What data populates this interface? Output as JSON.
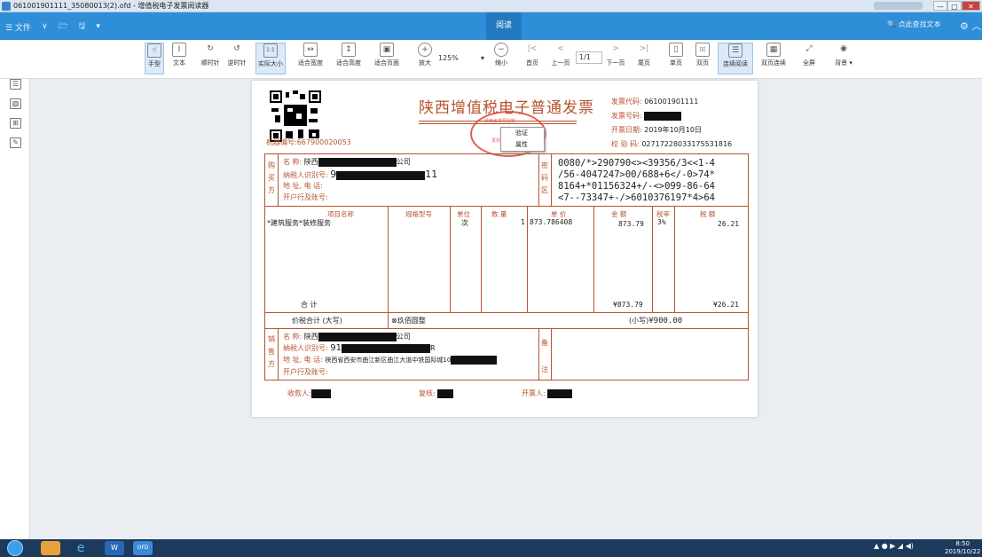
{
  "window": {
    "title": "061001901111_35080013(2).ofd - 增值税电子发票阅读器",
    "minimize": "—",
    "maximize": "□",
    "close": "✕"
  },
  "menubar": {
    "file": "☰ 文件",
    "items": [
      "∨",
      "🗁",
      "🖫",
      "▾"
    ],
    "read_tab": "阅读",
    "search": "🔍 点此查找文本",
    "settings": "⚙ ︿"
  },
  "toolbar": {
    "tools": [
      {
        "label": "手型",
        "glyph": "☝"
      },
      {
        "label": "文本",
        "glyph": "I"
      },
      {
        "label": "顺时针",
        "glyph": "↻"
      },
      {
        "label": "逆时针",
        "glyph": "↺"
      },
      {
        "label": "实际大小",
        "glyph": "1:1"
      },
      {
        "label": "适合宽度",
        "glyph": "↔"
      },
      {
        "label": "适合高度",
        "glyph": "↕"
      },
      {
        "label": "适合页面",
        "glyph": "▣"
      },
      {
        "label": "放大",
        "glyph": "+"
      },
      {
        "label": "缩小",
        "glyph": "−"
      },
      {
        "label": "首页",
        "glyph": "|<"
      },
      {
        "label": "上一页",
        "glyph": "<"
      },
      {
        "label": "下一页",
        "glyph": ">"
      },
      {
        "label": "尾页",
        "glyph": ">|"
      },
      {
        "label": "单页",
        "glyph": "▯"
      },
      {
        "label": "双页",
        "glyph": "▯▯"
      },
      {
        "label": "连续阅读",
        "glyph": "☰"
      },
      {
        "label": "双页连续",
        "glyph": "▦"
      },
      {
        "label": "全屏",
        "glyph": "⤢"
      },
      {
        "label": "背景 ▾",
        "glyph": "◉"
      }
    ],
    "zoom": "125%",
    "zoom_arrow": "▾",
    "page": "1/1"
  },
  "sidebar": {
    "icons": [
      "☰",
      "▧",
      "⊞",
      "✎"
    ]
  },
  "invoice": {
    "title": "陕西增值税电子普通发票",
    "code_label": "发票代码:",
    "code_value": "061001901111",
    "number_label": "发票号码:",
    "date_label": "开票日期:",
    "date_value": "2019年10月10日",
    "check_label": "校 验 码:",
    "check_value": "02717228033175531816",
    "machine_label": "机器编号:",
    "machine_value": "667900020053",
    "context_menu": [
      "验证",
      "属性"
    ],
    "buyer_side": [
      "购",
      "买",
      "方"
    ],
    "buyer_name_label": "名     称:",
    "buyer_name_prefix": "陕西",
    "buyer_name_suffix": "公司",
    "buyer_tax_label": "纳税人识别号:",
    "buyer_tax_prefix": "9",
    "buyer_tax_suffix": "11",
    "buyer_addr_label": "地 址, 电 话:",
    "buyer_bank_label": "开户行及账号:",
    "cipher_side": [
      "密",
      "码",
      "区"
    ],
    "cipher": "0080/*>290790<><39356/3<<1-4\n/56-4047247>00/688+6</-0>74*\n8164+*01156324+/-<>099-86-64\n<7--73347+-/>6010376197*4>64",
    "headers": {
      "item": "项目名称",
      "spec": "规格型号",
      "unit": "单位",
      "qty": "数 量",
      "price": "单 价",
      "amount": "金  额",
      "rate": "税率",
      "tax": "税  额"
    },
    "line": {
      "item": "*建筑服务*装修服务",
      "unit": "次",
      "qty": "1",
      "price": "873.786408",
      "amount": "873.79",
      "rate": "3%",
      "tax": "26.21"
    },
    "total_label": "合     计",
    "total_amount": "¥873.79",
    "total_tax": "¥26.21",
    "grand_label": "价税合计 (大写)",
    "grand_words": "⊗玖佰圆整",
    "grand_small_label": "(小写)",
    "grand_small_value": "¥900.00",
    "seller_side": [
      "销",
      "售",
      "方"
    ],
    "seller_name_label": "名     称:",
    "seller_name_prefix": "陕西",
    "seller_name_suffix": "公司",
    "seller_tax_label": "纳税人识别号:",
    "seller_tax_prefix": "91",
    "seller_tax_suffix": "R",
    "seller_addr_label": "地 址, 电 话:",
    "seller_addr_value": "陕西省西安市曲江新区曲江大道中铁国际城10",
    "seller_bank_label": "开户行及账号:",
    "remark_side": [
      "备",
      "注"
    ],
    "payee_label": "收款人:",
    "payee_prefix": "",
    "reviewer_label": "复核:",
    "drawer_label": "开票人:",
    "seal_top": "陕西省发票监制",
    "seal_bottom": "发票专用章"
  },
  "taskbar": {
    "apps": [
      "",
      "",
      "e",
      "W",
      "OFD"
    ],
    "tray": "▲ ● ▶ ◢ ◀)",
    "time": "8:50",
    "date": "2019/10/22"
  },
  "colors": {
    "titlebar": "#dbe6f3",
    "menubar": "#2f8ed8",
    "invoice_red": "#b6532e",
    "seal_red": "#d83b2e",
    "canvas": "#eaedf1",
    "taskbar": "#1b3a5c"
  }
}
